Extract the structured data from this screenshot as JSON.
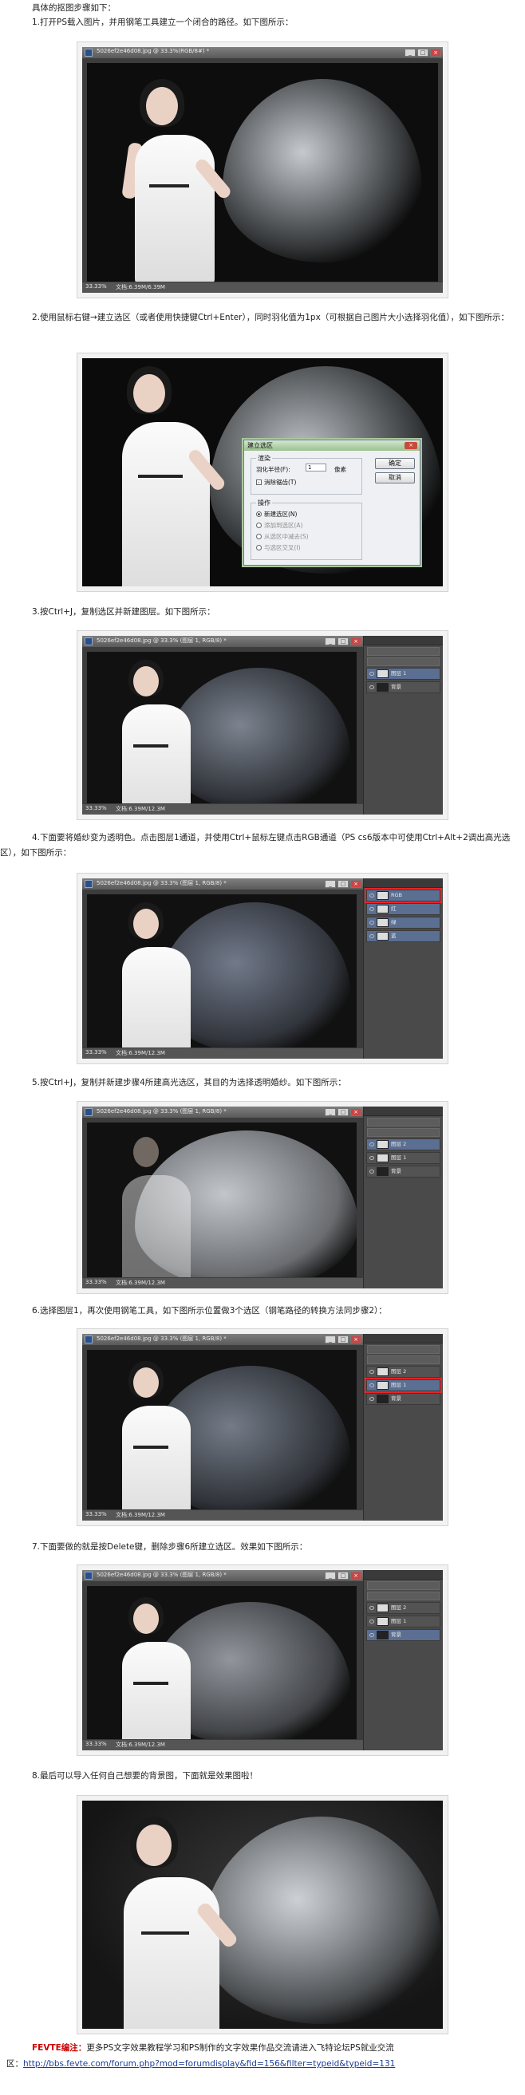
{
  "intro": "具体的抠图步骤如下：",
  "steps": [
    {
      "text": "1.打开PS载入图片，并用钢笔工具建立一个闭合的路径。如下图所示："
    },
    {
      "text": "2.使用鼠标右键→建立选区（或者使用快捷键Ctrl+Enter），同时羽化值为1px（可根据自己图片大小选择羽化值），如下图所示："
    },
    {
      "text": "3.按Ctrl+J，复制选区并新建图层。如下图所示："
    },
    {
      "text": "4.下面要将婚纱变为透明色。点击图层1通道，并使用Ctrl+鼠标左键点击RGB通道（PS cs6版本中可使用Ctrl+Alt+2调出高光选区），如下图所示："
    },
    {
      "text": "5.按Ctrl+J，复制并新建步骤4所建高光选区，其目的为选择透明婚纱。如下图所示："
    },
    {
      "text": "6.选择图层1，再次使用钢笔工具，如下图所示位置做3个选区（钢笔路径的转换方法同步骤2）："
    },
    {
      "text": "7.下面要做的就是按Delete键，删除步骤6所建立选区。效果如下图所示："
    },
    {
      "text": "8.最后可以导入任何自己想要的背景图，下面就是效果图啦！"
    }
  ],
  "ps": {
    "title1": "5026ef2e46d08.jpg @ 33.3%(RGB/8#) *",
    "title": "5026ef2e46d08.jpg @ 33.3% (图层 1, RGB/8) *",
    "zoom": "33.33%",
    "doc": "文档:6.39M/6.39M",
    "doc2": "文档:6.39M/12.3M",
    "layers": {
      "layer1": "图层 1",
      "layer2": "图层 2",
      "bg": "背景"
    },
    "channels": [
      "RGB",
      "红",
      "绿",
      "蓝"
    ]
  },
  "dialog": {
    "title": "建立选区",
    "render_legend": "渲染",
    "feather_label": "羽化半径(F):",
    "feather_value": "1",
    "feather_unit": "像素",
    "antialias": "消除锯齿(T)",
    "op_legend": "操作",
    "new_sel": "新建选区(N)",
    "add_sel": "添加到选区(A)",
    "sub_sel": "从选区中减去(S)",
    "int_sel": "与选区交叉(I)",
    "ok": "确定",
    "cancel": "取消"
  },
  "footer": {
    "brand": "FEVTE编注：",
    "text": "更多PS文字效果教程学习和PS制作的文字效果作品交流请进入飞特论坛PS就业交流",
    "prefix": "区：",
    "link": "http://bbs.fevte.com/forum.php?mod=forumdisplay&fid=156&filter=typeid&typeid=131"
  }
}
